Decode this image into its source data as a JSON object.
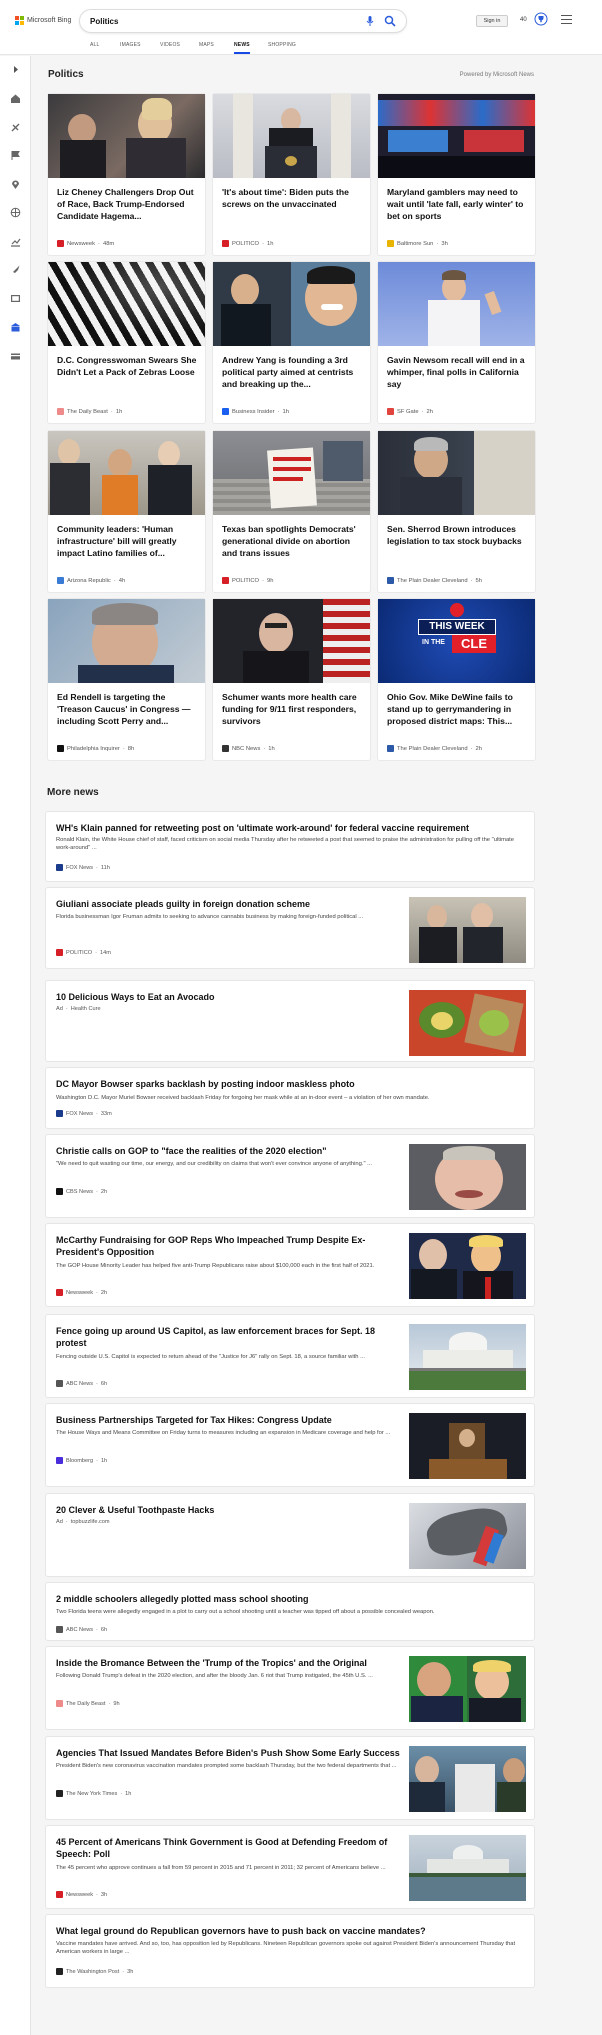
{
  "header": {
    "brand": "Microsoft Bing",
    "query": "Politics",
    "signin": "Sign in",
    "rewards_count": "40"
  },
  "tabs": [
    "ALL",
    "IMAGES",
    "VIDEOS",
    "MAPS",
    "NEWS",
    "SHOPPING"
  ],
  "active_tab": "NEWS",
  "section": {
    "title": "Politics",
    "powered_by": "Powered by Microsoft News"
  },
  "cards": [
    {
      "title": "Liz Cheney Challengers Drop Out of Race, Back Trump-Endorsed Candidate Hagema...",
      "source": "Newsweek",
      "time": "48m",
      "icon_color": "#d61f26"
    },
    {
      "title": "'It's about time': Biden puts the screws on the unvaccinated",
      "source": "POLITICO",
      "time": "1h",
      "icon_color": "#d61f26"
    },
    {
      "title": "Maryland gamblers may need to wait until 'late fall, early winter' to bet on sports",
      "source": "Baltimore Sun",
      "time": "3h",
      "icon_color": "#e8b400"
    },
    {
      "title": "D.C. Congresswoman Swears She Didn't Let a Pack of Zebras Loose",
      "source": "The Daily Beast",
      "time": "1h",
      "icon_color": "#ef8a8a"
    },
    {
      "title": "Andrew Yang is founding a 3rd political party aimed at centrists and breaking up the...",
      "source": "Business Insider",
      "time": "1h",
      "icon_color": "#1a5ff0"
    },
    {
      "title": "Gavin Newsom recall will end in a whimper, final polls in California say",
      "source": "SF Gate",
      "time": "2h",
      "icon_color": "#e0443d"
    },
    {
      "title": "Community leaders: 'Human infrastructure' bill will greatly impact Latino families of...",
      "source": "Arizona Republic",
      "time": "4h",
      "icon_color": "#3a7bd5"
    },
    {
      "title": "Texas ban spotlights Democrats' generational divide on abortion and trans issues",
      "source": "POLITICO",
      "time": "9h",
      "icon_color": "#d61f26"
    },
    {
      "title": "Sen. Sherrod Brown introduces legislation to tax stock buybacks",
      "source": "The Plain Dealer Cleveland",
      "time": "5h",
      "icon_color": "#2c5aa8"
    },
    {
      "title": "Ed Rendell is targeting the 'Treason Caucus' in Congress — including Scott Perry and...",
      "source": "Philadelphia Inquirer",
      "time": "8h",
      "icon_color": "#111111"
    },
    {
      "title": "Schumer wants more health care funding for 9/11 first responders, survivors",
      "source": "NBC News",
      "time": "1h",
      "icon_color": "#333333"
    },
    {
      "title": "Ohio Gov. Mike DeWine fails to stand up to gerrymandering in proposed district maps: This...",
      "source": "The Plain Dealer Cleveland",
      "time": "2h",
      "icon_color": "#2c5aa8"
    }
  ],
  "card_images": {
    "c11_line1": "THIS WEEK",
    "c11_line2": "IN THE",
    "c11_line3": "CLE"
  },
  "more_news_title": "More news",
  "news": [
    {
      "title": "WH's Klain panned for retweeting post on 'ultimate work-around' for federal vaccine requirement",
      "snippet": "Ronald Klain, the White House chief of staff, faced criticism on social media Thursday after he retweeted a post that seemed to praise the administration for pulling off the \"ultimate work-around\" ...",
      "source": "FOX News",
      "time": "11h",
      "icon_color": "#1b3c8c",
      "ad": false
    },
    {
      "title": "Giuliani associate pleads guilty in foreign donation scheme",
      "snippet": "Florida businessman Igor Fruman admits to seeking to advance cannabis business by making foreign-funded political ...",
      "source": "POLITICO",
      "time": "14m",
      "icon_color": "#d61f26",
      "ad": false
    },
    {
      "title": "10 Delicious Ways to Eat an Avocado",
      "snippet": "",
      "source": "Health Cure",
      "time": "",
      "icon_color": "",
      "ad": true
    },
    {
      "title": "DC Mayor Bowser sparks backlash by posting indoor maskless photo",
      "snippet": "Washington D.C. Mayor Muriel Bowser received backlash Friday for forgoing her mask while at an in-door event – a violation of her own mandate.",
      "source": "FOX News",
      "time": "33m",
      "icon_color": "#1b3c8c",
      "ad": false
    },
    {
      "title": "Christie calls on GOP to \"face the realities of the 2020 election\"",
      "snippet": "\"We need to quit wasting our time, our energy, and our credibility on claims that won't ever convince anyone of anything.\" ...",
      "source": "CBS News",
      "time": "2h",
      "icon_color": "#111111",
      "ad": false
    },
    {
      "title": "McCarthy Fundraising for GOP Reps Who Impeached Trump Despite Ex-President's Opposition",
      "snippet": "The GOP House Minority Leader has helped five anti-Trump Republicans raise about $100,000 each in the first half of 2021.",
      "source": "Newsweek",
      "time": "2h",
      "icon_color": "#d61f26",
      "ad": false
    },
    {
      "title": "Fence going up around US Capitol, as law enforcement braces for Sept. 18 protest",
      "snippet": "Fencing outside U.S. Capitol is expected to return ahead of the \"Justice for J6\" rally on Sept. 18, a source familiar with ...",
      "source": "ABC News",
      "time": "6h",
      "icon_color": "#555555",
      "ad": false
    },
    {
      "title": "Business Partnerships Targeted for Tax Hikes: Congress Update",
      "snippet": "The House Ways and Means Committee on Friday turns to measures including an expansion in Medicare coverage and help for ...",
      "source": "Bloomberg",
      "time": "1h",
      "icon_color": "#4a2ddb",
      "ad": false
    },
    {
      "title": "20 Clever & Useful Toothpaste Hacks",
      "snippet": "",
      "source": "topbuzzlife.com",
      "time": "",
      "icon_color": "",
      "ad": true
    },
    {
      "title": "2 middle schoolers allegedly plotted mass school shooting",
      "snippet": "Two Florida teens were allegedly engaged in a plot to carry out a school shooting until a teacher was tipped off about a possible concealed weapon.",
      "source": "ABC News",
      "time": "6h",
      "icon_color": "#555555",
      "ad": false
    },
    {
      "title": "Inside the Bromance Between the 'Trump of the Tropics' and the Original",
      "snippet": "Following Donald Trump's defeat in the 2020 election, and after the bloody Jan. 6 riot that Trump instigated, the 45th U.S. ...",
      "source": "The Daily Beast",
      "time": "9h",
      "icon_color": "#ef8a8a",
      "ad": false
    },
    {
      "title": "Agencies That Issued Mandates Before Biden's Push Show Some Early Success",
      "snippet": "President Biden's new coronavirus vaccination mandates prompted some backlash Thursday, but the two federal departments that ...",
      "source": "The New York Times",
      "time": "1h",
      "icon_color": "#222222",
      "ad": false
    },
    {
      "title": "45 Percent of Americans Think Government is Good at Defending Freedom of Speech: Poll",
      "snippet": "The 45 percent who approve continues a fall from 59 percent in 2015 and 71 percent in 2011; 32 percent of Americans believe ...",
      "source": "Newsweek",
      "time": "3h",
      "icon_color": "#d61f26",
      "ad": false
    },
    {
      "title": "What legal ground do Republican governors have to push back on vaccine mandates?",
      "snippet": "Vaccine mandates have arrived. And so, too, has opposition led by Republicans. Nineteen Republican governors spoke out against President Biden's announcement Thursday that American workers in large ...",
      "source": "The Washington Post",
      "time": "3h",
      "icon_color": "#222222",
      "ad": false
    }
  ],
  "ad_label": "Ad",
  "colors": {
    "accent": "#174ae4",
    "brand_red": "#f25022",
    "brand_green": "#7fba00",
    "brand_blue": "#00a4ef",
    "brand_yellow": "#ffb900"
  },
  "rail_icons": [
    "expand-icon",
    "home-icon",
    "explore-icon",
    "flag-icon",
    "location-icon",
    "globe-icon",
    "chart-icon",
    "rocket-icon",
    "tv-icon",
    "bank-icon",
    "card-icon"
  ]
}
